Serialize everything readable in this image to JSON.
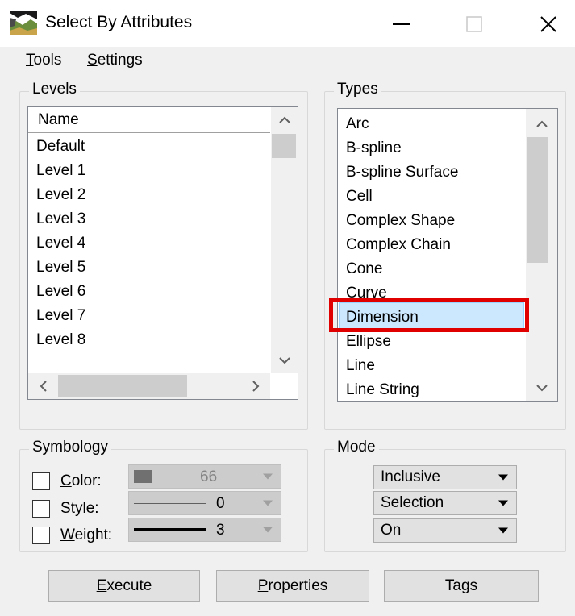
{
  "window": {
    "title": "Select By Attributes",
    "controls": {
      "minimize": "—",
      "maximize": "☐",
      "close": "✕"
    }
  },
  "menu": [
    {
      "accel": "T",
      "rest": "ools"
    },
    {
      "accel": "S",
      "rest": "ettings"
    }
  ],
  "levels": {
    "group_label": "Levels",
    "column_header": "Name",
    "items": [
      "Default",
      "Level 1",
      "Level 2",
      "Level 3",
      "Level 4",
      "Level 5",
      "Level 6",
      "Level 7",
      "Level 8"
    ]
  },
  "types": {
    "group_label": "Types",
    "items": [
      "Arc",
      "B-spline",
      "B-spline Surface",
      "Cell",
      "Complex Shape",
      "Complex Chain",
      "Cone",
      "Curve",
      "Dimension",
      "Ellipse",
      "Line",
      "Line String"
    ],
    "selected": "Dimension"
  },
  "symbology": {
    "group_label": "Symbology",
    "color": {
      "accel": "C",
      "rest": "olor:",
      "value": "66",
      "swatch": "#707070"
    },
    "style": {
      "accel": "S",
      "rest": "tyle:",
      "value": "0"
    },
    "weight": {
      "accel": "W",
      "rest": "eight:",
      "value": "3"
    }
  },
  "mode": {
    "group_label": "Mode",
    "options": [
      "Inclusive",
      "Selection",
      "On"
    ]
  },
  "buttons": {
    "execute": {
      "accel": "E",
      "rest": "xecute"
    },
    "properties": {
      "accel": "P",
      "rest": "roperties"
    },
    "tags": {
      "pre": "Ta",
      "accel": "g",
      "rest": "s"
    }
  },
  "colors": {
    "selection_fill": "#cce8ff",
    "highlight_box": "#e00000"
  }
}
